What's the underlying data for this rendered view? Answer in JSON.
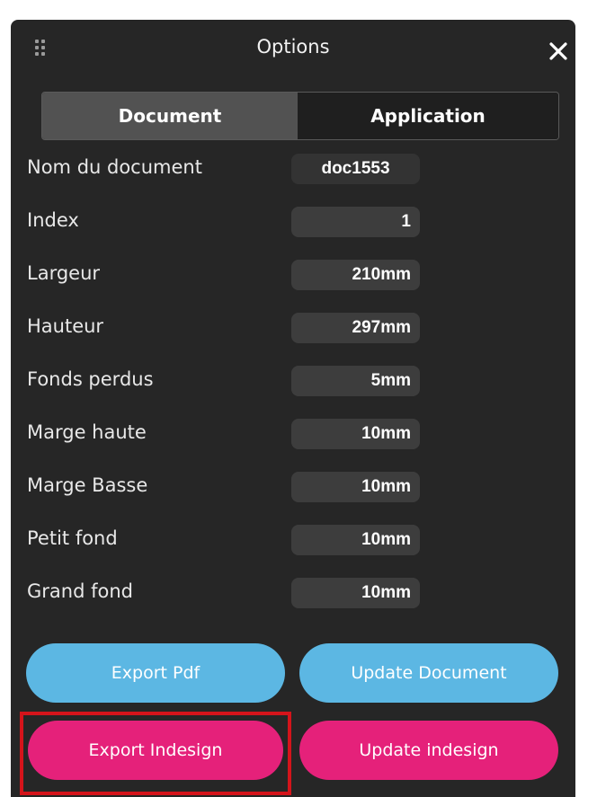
{
  "header": {
    "title": "Options",
    "grip_icon": "drag-grip-icon",
    "close_icon": "close-icon"
  },
  "tabs": [
    {
      "label": "Document",
      "active": true
    },
    {
      "label": "Application",
      "active": false
    }
  ],
  "fields": [
    {
      "label": "Nom du document",
      "value": "doc1553"
    },
    {
      "label": "Index",
      "value": "1"
    },
    {
      "label": "Largeur",
      "value": "210mm"
    },
    {
      "label": "Hauteur",
      "value": "297mm"
    },
    {
      "label": "Fonds perdus",
      "value": "5mm"
    },
    {
      "label": "Marge haute",
      "value": "10mm"
    },
    {
      "label": "Marge Basse",
      "value": "10mm"
    },
    {
      "label": "Petit fond",
      "value": "10mm"
    },
    {
      "label": "Grand fond",
      "value": "10mm"
    }
  ],
  "buttons": {
    "export_pdf": "Export Pdf",
    "update_document": "Update Document",
    "export_indesign": "Export Indesign",
    "update_indesign": "Update indesign"
  },
  "colors": {
    "panel_bg": "#262626",
    "blue_button": "#5cb7e3",
    "pink_button": "#e5217a",
    "highlight_border": "#d4141b"
  }
}
